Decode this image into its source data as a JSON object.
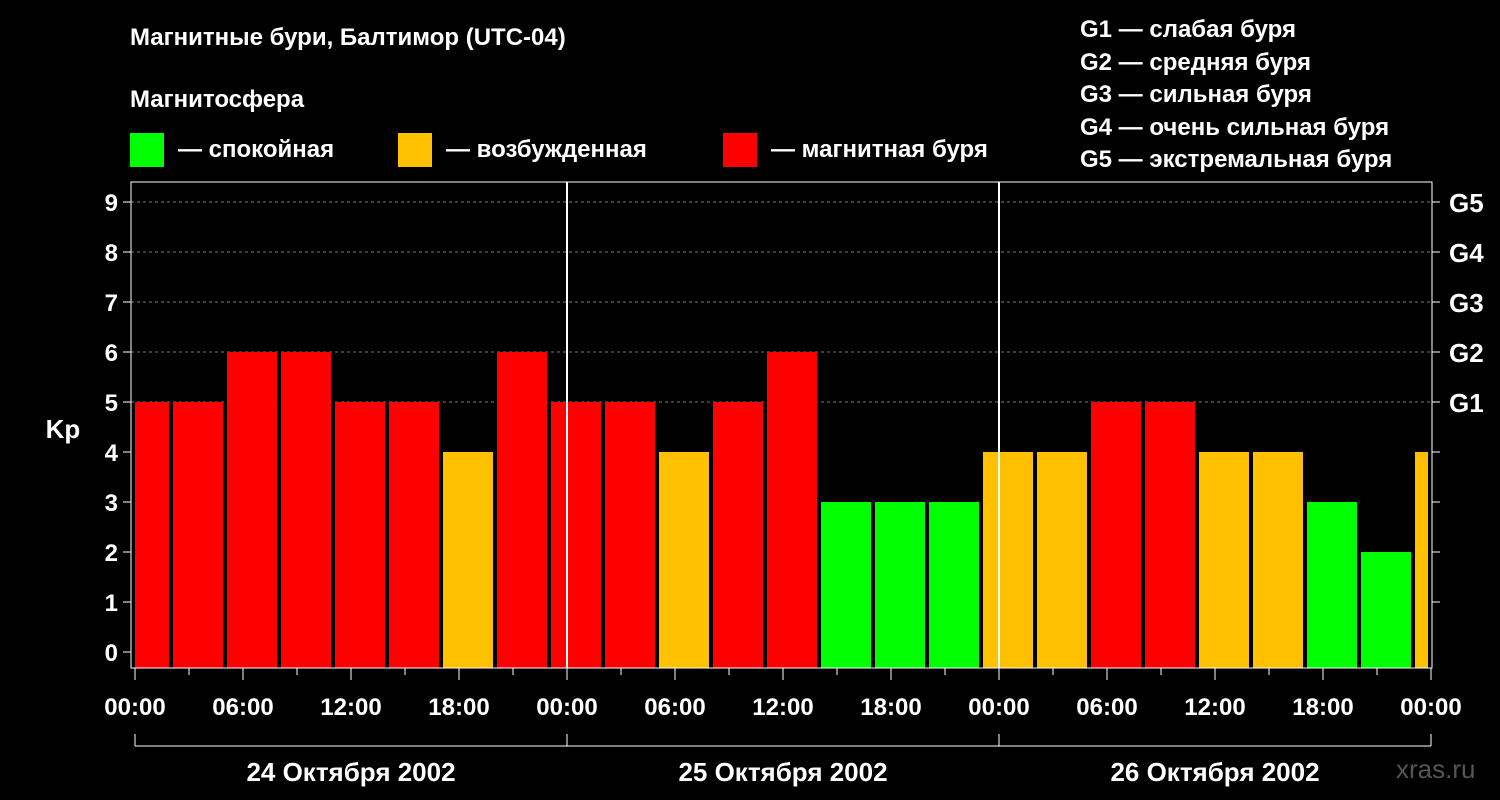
{
  "title": "Магнитные бури, Балтимор (UTC-04)",
  "legend": {
    "heading": "Магнитосфера",
    "items": [
      {
        "label": "— спокойная",
        "color": "#00ff00"
      },
      {
        "label": "— возбужденная",
        "color": "#ffc000"
      },
      {
        "label": "— магнитная буря",
        "color": "#ff0000"
      }
    ]
  },
  "g_scale_legend": [
    "G1 — слабая буря",
    "G2 — средняя буря",
    "G3 — сильная буря",
    "G4 — очень сильная буря",
    "G5 — экстремальная буря"
  ],
  "watermark": "xras.ru",
  "chart_data": {
    "type": "bar",
    "ylabel": "Kp",
    "ylim": [
      0,
      9
    ],
    "yticks": [
      0,
      1,
      2,
      3,
      4,
      5,
      6,
      7,
      8,
      9
    ],
    "right_axis": [
      {
        "kp": 5,
        "label": "G1"
      },
      {
        "kp": 6,
        "label": "G2"
      },
      {
        "kp": 7,
        "label": "G3"
      },
      {
        "kp": 8,
        "label": "G4"
      },
      {
        "kp": 9,
        "label": "G5"
      }
    ],
    "xtick_labels": [
      "00:00",
      "06:00",
      "12:00",
      "18:00",
      "00:00",
      "06:00",
      "12:00",
      "18:00",
      "00:00",
      "06:00",
      "12:00",
      "18:00",
      "00:00"
    ],
    "dates": [
      "24 Октября 2002",
      "25 Октября 2002",
      "26 Октября 2002"
    ],
    "interval_hours": 3,
    "start_offset_hours": -1,
    "values": [
      5,
      5,
      6,
      6,
      5,
      5,
      4,
      6,
      5,
      5,
      4,
      5,
      6,
      3,
      3,
      3,
      4,
      4,
      5,
      5,
      4,
      4,
      3,
      2,
      4
    ],
    "level_colors": {
      "quiet": "#00ff00",
      "unsettled": "#ffc000",
      "storm": "#ff0000"
    },
    "grid": true
  }
}
